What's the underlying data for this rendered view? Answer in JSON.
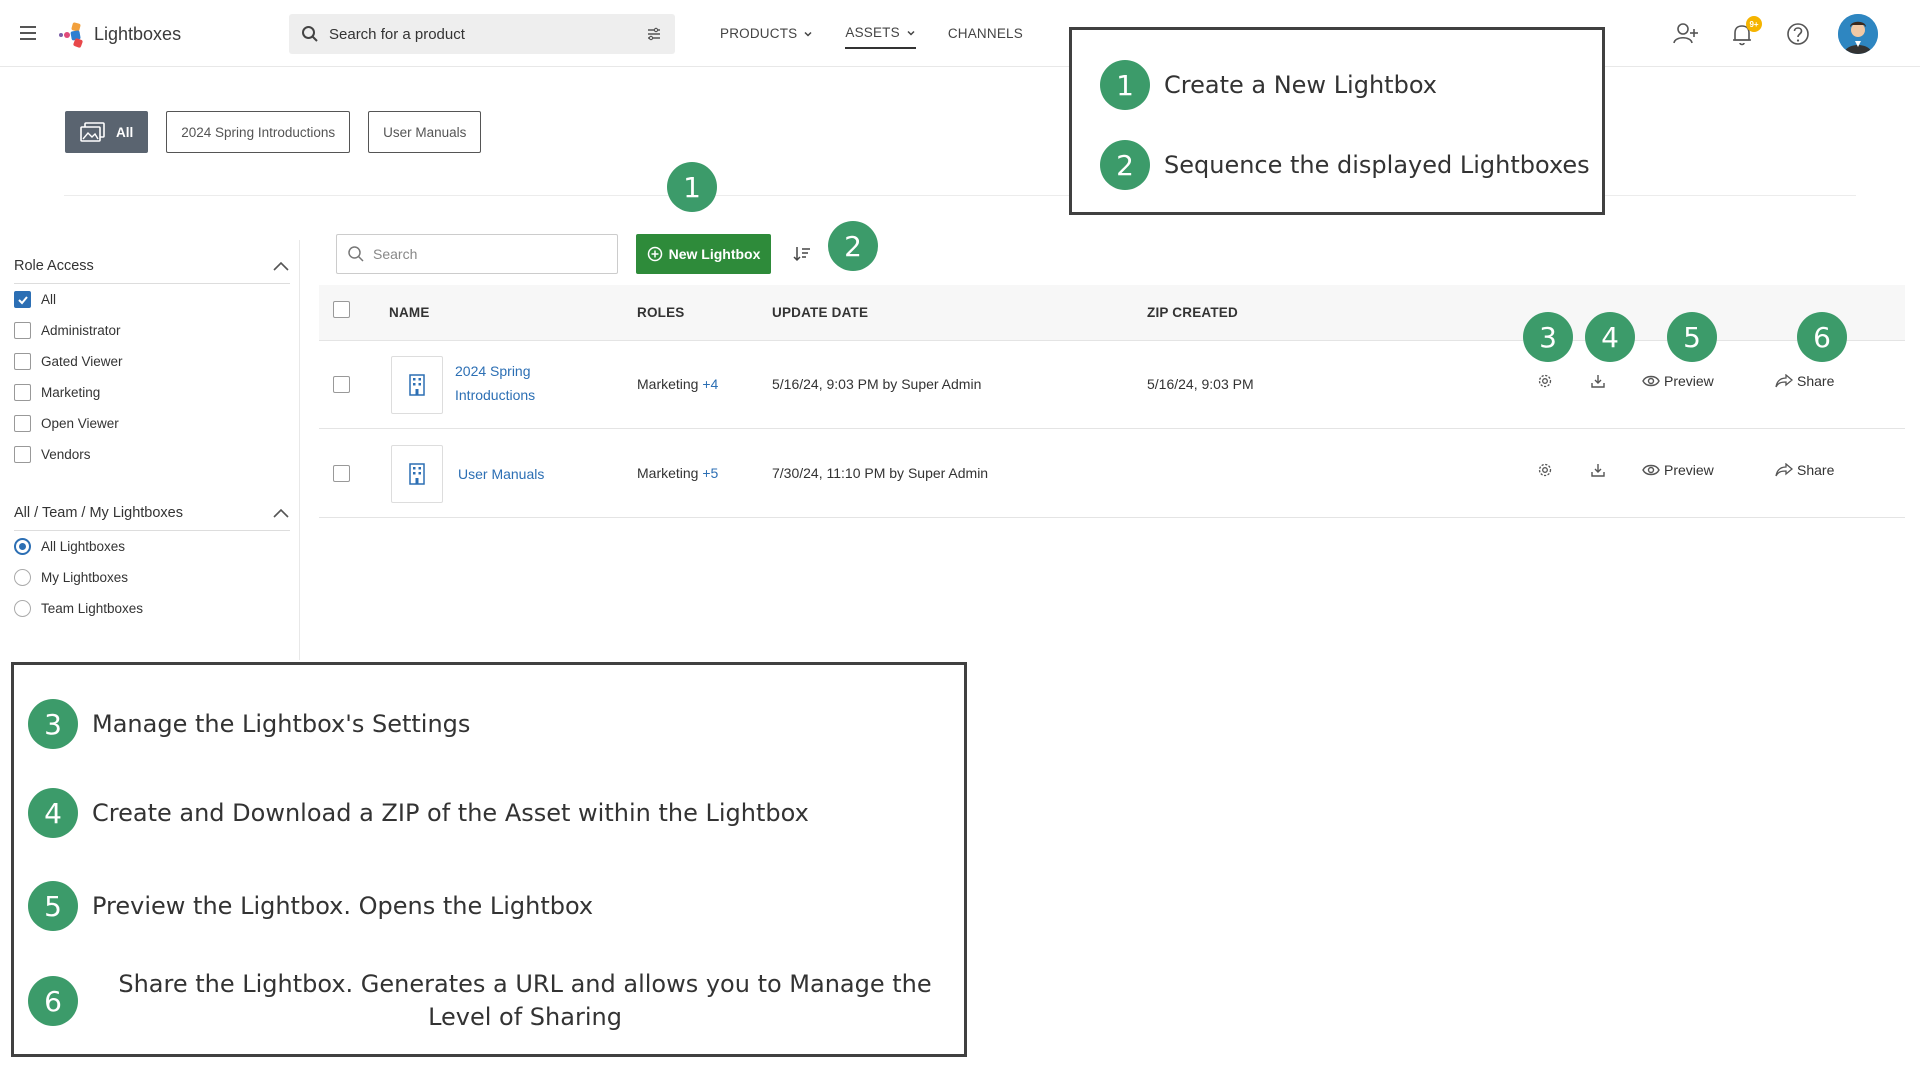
{
  "app": {
    "name": "Lightboxes"
  },
  "search": {
    "placeholder": "Search for a product"
  },
  "nav": [
    {
      "label": "PRODUCTS"
    },
    {
      "label": "ASSETS"
    },
    {
      "label": "CHANNELS"
    }
  ],
  "notifications": {
    "badge": "9+"
  },
  "tabs": [
    {
      "label": "All"
    },
    {
      "label": "2024 Spring Introductions"
    },
    {
      "label": "User Manuals"
    }
  ],
  "sidebar": {
    "role_access": {
      "title": "Role Access",
      "options": [
        {
          "label": "All",
          "checked": true
        },
        {
          "label": "Administrator",
          "checked": false
        },
        {
          "label": "Gated Viewer",
          "checked": false
        },
        {
          "label": "Marketing",
          "checked": false
        },
        {
          "label": "Open Viewer",
          "checked": false
        },
        {
          "label": "Vendors",
          "checked": false
        }
      ]
    },
    "scope": {
      "title": "All / Team / My Lightboxes",
      "options": [
        {
          "label": "All Lightboxes",
          "selected": true
        },
        {
          "label": "My Lightboxes",
          "selected": false
        },
        {
          "label": "Team Lightboxes",
          "selected": false
        }
      ]
    }
  },
  "toolbar": {
    "search_placeholder": "Search",
    "new_button": "New Lightbox"
  },
  "table": {
    "columns": [
      "NAME",
      "ROLES",
      "UPDATE DATE",
      "ZIP CREATED"
    ],
    "rows": [
      {
        "name_line1": "2024 Spring",
        "name_line2": "Introductions",
        "roles": "Marketing",
        "roles_extra": "+4",
        "update_date": "5/16/24, 9:03 PM by Super Admin",
        "zip_created": "5/16/24, 9:03 PM",
        "preview": "Preview",
        "share": "Share"
      },
      {
        "name_line1": "User Manuals",
        "name_line2": "",
        "roles": "Marketing",
        "roles_extra": "+5",
        "update_date": "7/30/24, 11:10 PM by Super Admin",
        "zip_created": "",
        "preview": "Preview",
        "share": "Share"
      }
    ]
  },
  "markers": [
    "1",
    "2",
    "3",
    "4",
    "5",
    "6"
  ],
  "legend_top": [
    {
      "num": "1",
      "text": "Create a New Lightbox"
    },
    {
      "num": "2",
      "text": "Sequence the displayed Lightboxes"
    }
  ],
  "legend_bottom": [
    {
      "num": "3",
      "text": "Manage the Lightbox's Settings"
    },
    {
      "num": "4",
      "text": "Create and Download a ZIP of the Asset within the Lightbox"
    },
    {
      "num": "5",
      "text": "Preview the Lightbox. Opens the Lightbox"
    },
    {
      "num": "6",
      "text": "Share the Lightbox. Generates a URL and allows you to Manage the Level of Sharing"
    }
  ],
  "colors": {
    "accent_green": "#2e8b3a",
    "marker_green": "#3c9b6a",
    "link_blue": "#2c6fb4",
    "badge_yellow": "#f5b400"
  }
}
